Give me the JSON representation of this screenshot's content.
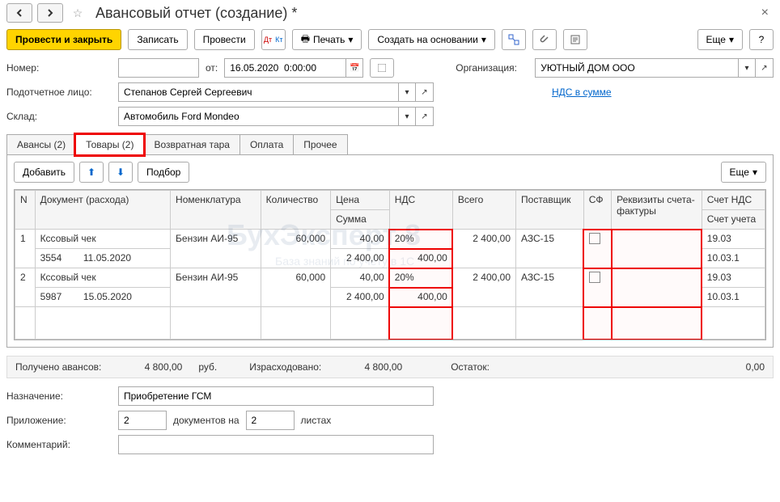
{
  "header": {
    "title": "Авансовый отчет (создание) *"
  },
  "toolbar": {
    "post_close": "Провести и закрыть",
    "save": "Записать",
    "post": "Провести",
    "print": "Печать",
    "create_based": "Создать на основании",
    "more": "Еще",
    "help": "?"
  },
  "fields": {
    "number_label": "Номер:",
    "from_label": "от:",
    "date_value": "16.05.2020  0:00:00",
    "org_label": "Организация:",
    "org_value": "УЮТНЫЙ ДОМ ООО",
    "person_label": "Подотчетное лицо:",
    "person_value": "Степанов Сергей Сергеевич",
    "vat_link": "НДС в сумме",
    "warehouse_label": "Склад:",
    "warehouse_value": "Автомобиль Ford Mondeo"
  },
  "tabs": {
    "advances": "Авансы (2)",
    "goods": "Товары (2)",
    "returnable": "Возвратная тара",
    "payment": "Оплата",
    "other": "Прочее"
  },
  "tab_toolbar": {
    "add": "Добавить",
    "pick": "Подбор",
    "more": "Еще"
  },
  "columns": {
    "n": "N",
    "doc": "Документ (расхода)",
    "nomen": "Номенклатура",
    "qty": "Количество",
    "price": "Цена",
    "sum": "Сумма",
    "vat": "НДС",
    "total": "Всего",
    "supplier": "Поставщик",
    "sf": "СФ",
    "invoice": "Реквизиты счета-фактуры",
    "acct_vat": "Счет НДС",
    "acct": "Счет учета"
  },
  "rows": [
    {
      "n": "1",
      "doc_type": "Кссовый чек",
      "doc_num": "3554",
      "doc_date": "11.05.2020",
      "nomen": "Бензин АИ-95",
      "qty": "60,000",
      "price": "40,00",
      "sum": "2 400,00",
      "vat_rate": "20%",
      "vat_amount": "400,00",
      "total": "2 400,00",
      "supplier": "АЗС-15",
      "acct_vat": "19.03",
      "acct": "10.03.1"
    },
    {
      "n": "2",
      "doc_type": "Кссовый чек",
      "doc_num": "5987",
      "doc_date": "15.05.2020",
      "nomen": "Бензин АИ-95",
      "qty": "60,000",
      "price": "40,00",
      "sum": "2 400,00",
      "vat_rate": "20%",
      "vat_amount": "400,00",
      "total": "2 400,00",
      "supplier": "АЗС-15",
      "acct_vat": "19.03",
      "acct": "10.03.1"
    }
  ],
  "summary": {
    "advances_label": "Получено авансов:",
    "advances_value": "4 800,00",
    "currency": "руб.",
    "spent_label": "Израсходовано:",
    "spent_value": "4 800,00",
    "balance_label": "Остаток:",
    "balance_value": "0,00"
  },
  "bottom": {
    "purpose_label": "Назначение:",
    "purpose_value": "Приобретение ГСМ",
    "attachment_label": "Приложение:",
    "att_docs": "2",
    "att_docs_label": "документов на",
    "att_sheets": "2",
    "att_sheets_label": "листах",
    "comment_label": "Комментарий:"
  },
  "watermark": {
    "main": "БухЭксперт 8",
    "sub": "База знаний по учёту в 1С"
  }
}
